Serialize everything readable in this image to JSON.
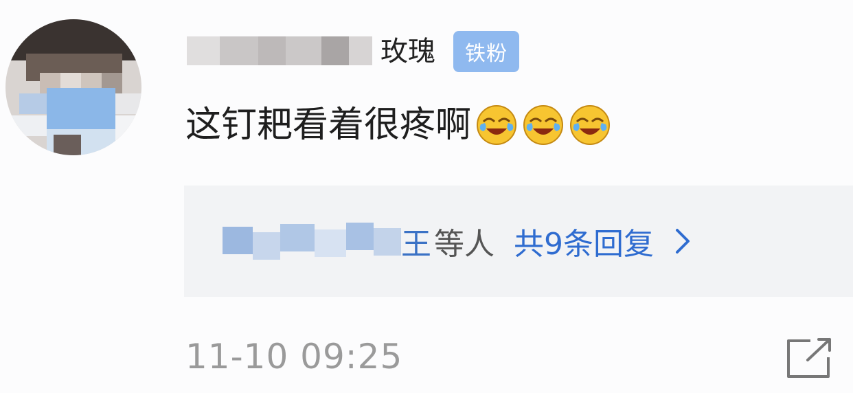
{
  "comment": {
    "username": "玫瑰",
    "badge": "铁粉",
    "text": "这钉耙看着很疼啊",
    "emojis": [
      "laugh-cry-emoji",
      "laugh-cry-emoji",
      "laugh-cry-emoji"
    ],
    "timestamp": "11-10 09:25"
  },
  "replies": {
    "names_visible": "王",
    "suffix": "等人",
    "count_label": "共9条回复"
  },
  "icons": {
    "chevron": "chevron-right-icon",
    "share": "share-icon"
  },
  "colors": {
    "badge": "#8fb9ef",
    "link": "#2f6cd0",
    "timestamp": "#9a9a9a"
  }
}
